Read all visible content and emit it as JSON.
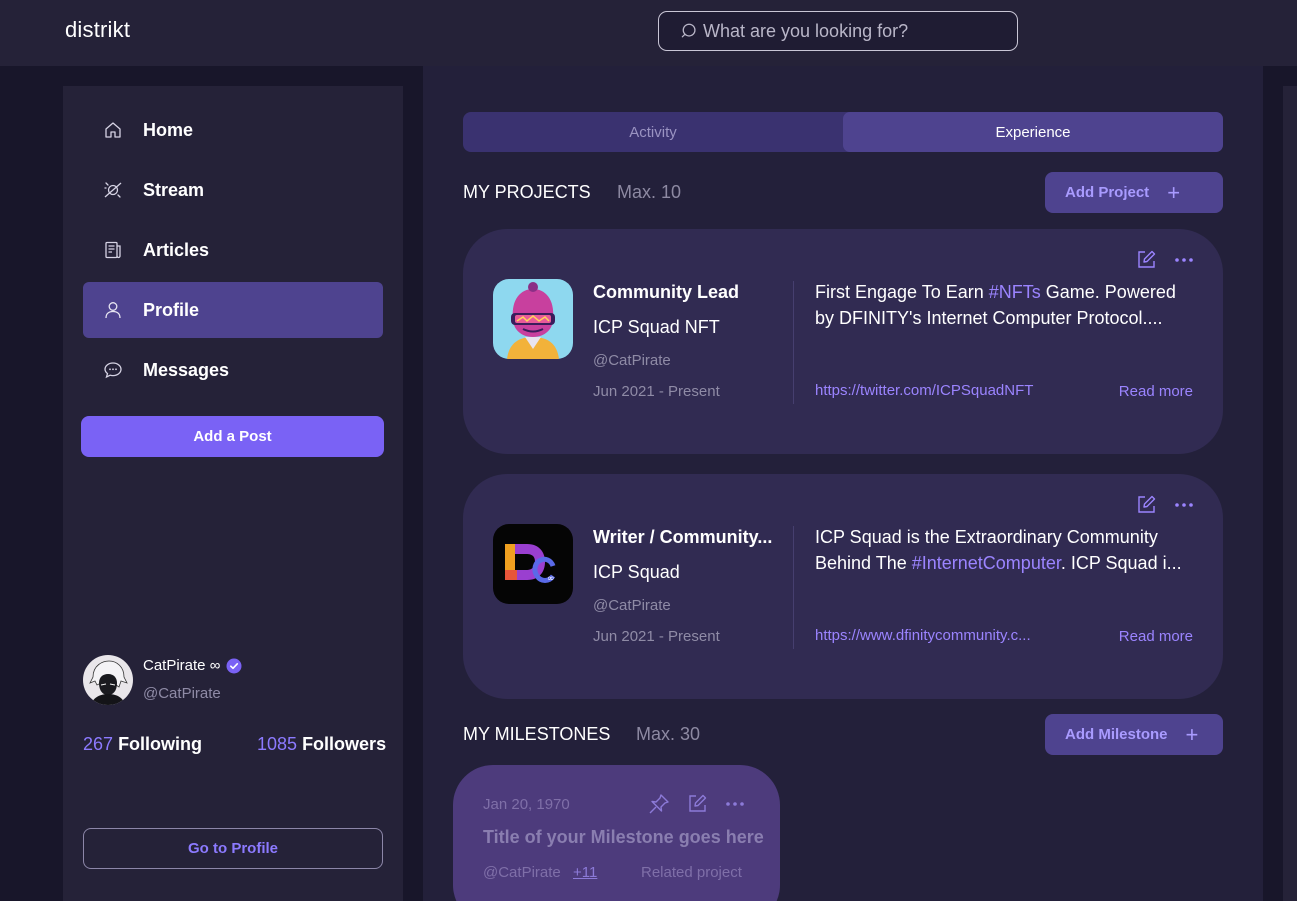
{
  "app": {
    "logo": "distrikt"
  },
  "search": {
    "placeholder": "What are you looking for?"
  },
  "sidebar": {
    "items": [
      {
        "label": "Home",
        "icon": "home-icon"
      },
      {
        "label": "Stream",
        "icon": "stream-icon"
      },
      {
        "label": "Articles",
        "icon": "articles-icon"
      },
      {
        "label": "Profile",
        "icon": "profile-icon",
        "active": true
      },
      {
        "label": "Messages",
        "icon": "messages-icon"
      }
    ],
    "add_post": "Add a Post"
  },
  "user": {
    "name": "CatPirate ∞",
    "handle": "@CatPirate",
    "following_count": "267",
    "following_label": "Following",
    "followers_count": "1085",
    "followers_label": "Followers",
    "go_to_profile": "Go to Profile"
  },
  "tabs": [
    {
      "label": "Activity",
      "active": false
    },
    {
      "label": "Experience",
      "active": true
    }
  ],
  "projects": {
    "title": "MY PROJECTS",
    "max": "Max. 10",
    "add_label": "Add Project",
    "items": [
      {
        "role": "Community Lead",
        "company": "ICP Squad NFT",
        "handle": "@CatPirate",
        "dates": "Jun 2021 - Present",
        "desc_line1_pre": "First Engage To Earn ",
        "desc_line1_tag": "#NFTs",
        "desc_line1_post": " Game. Powered",
        "desc_line2_pre": "by DFINITY's Internet Computer Protocol....",
        "desc_line2_tag": "",
        "desc_line2_post": "",
        "link": "https://twitter.com/ICPSquadNFT",
        "read_more": "Read more"
      },
      {
        "role": "Writer / Community...",
        "company": "ICP Squad",
        "handle": "@CatPirate",
        "dates": "Jun 2021 - Present",
        "desc_line1_pre": "ICP Squad is the Extraordinary Community",
        "desc_line1_tag": "",
        "desc_line1_post": "",
        "desc_line2_pre": "Behind The ",
        "desc_line2_tag": "#InternetComputer",
        "desc_line2_post": ". ICP Squad i...",
        "link": "https://www.dfinitycommunity.c...",
        "read_more": "Read more"
      }
    ]
  },
  "milestones": {
    "title": "MY MILESTONES",
    "max": "Max. 30",
    "add_label": "Add Milestone",
    "item": {
      "date": "Jan 20, 1970",
      "title": "Title of your Milestone goes here",
      "handle": "@CatPirate",
      "more": "+11",
      "related": "Related project"
    }
  },
  "colors": {
    "accent": "#7a62f5",
    "link": "#9b84ff",
    "card": "#312b52",
    "active_nav": "#4e438f"
  }
}
